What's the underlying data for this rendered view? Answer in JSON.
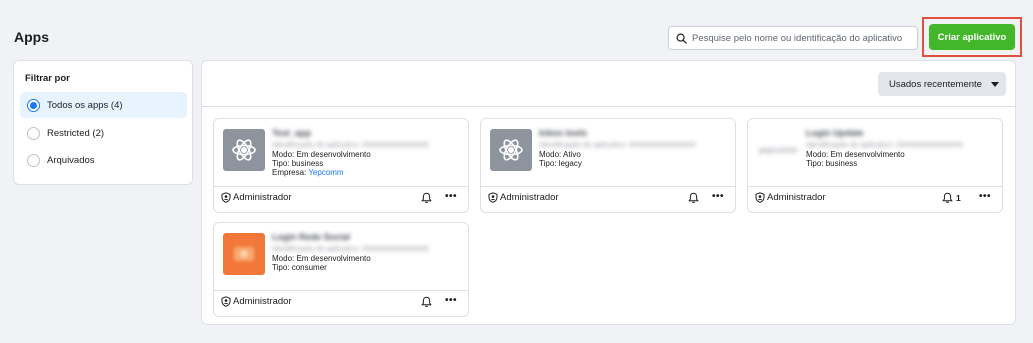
{
  "page": {
    "title": "Apps"
  },
  "search": {
    "placeholder": "Pesquise pelo nome ou identificação do aplicativo"
  },
  "create_button": {
    "label": "Criar aplicativo"
  },
  "filter": {
    "title": "Filtrar por",
    "options": [
      {
        "label": "Todos os apps (4)",
        "selected": true
      },
      {
        "label": "Restricted (2)",
        "selected": false
      },
      {
        "label": "Arquivados",
        "selected": false
      }
    ]
  },
  "sort": {
    "label": "Usados recentemente"
  },
  "apps": [
    {
      "name": "Test_app",
      "id_line": "Identificação do aplicativo: 0000000000000000",
      "lines": [
        "Modo: Em desenvolvimento",
        "Tipo: business"
      ],
      "company_label": "Empresa:",
      "company": "Yepcomm",
      "role": "Administrador",
      "notifications": "",
      "icon": "atom-icon",
      "thumb_color": "#8d949e"
    },
    {
      "name": "Inbox tools",
      "id_line": "Identificação do aplicativo: 0000000000000000",
      "lines": [
        "Modo: Ativo",
        "Tipo: legacy"
      ],
      "role": "Administrador",
      "notifications": "",
      "icon": "atom-icon",
      "thumb_color": "#8d949e"
    },
    {
      "name": "Login Update",
      "id_line": "Identificação do aplicativo: 0000000000000000",
      "lines": [
        "Modo: Em desenvolvimento",
        "Tipo: business"
      ],
      "thumb_text": "yepcomm",
      "role": "Administrador",
      "notifications": "1",
      "icon": "",
      "thumb_color": ""
    },
    {
      "name": "Login Rede Social",
      "id_line": "Identificação do aplicativo: 0000000000000000",
      "lines": [
        "Modo: Em desenvolvimento",
        "Tipo: consumer"
      ],
      "role": "Administrador",
      "notifications": "",
      "icon": "app-logo",
      "thumb_color": "#f2783a"
    }
  ],
  "colors": {
    "accent": "#42b72a",
    "link": "#1877f2",
    "highlight": "#e0503c"
  }
}
